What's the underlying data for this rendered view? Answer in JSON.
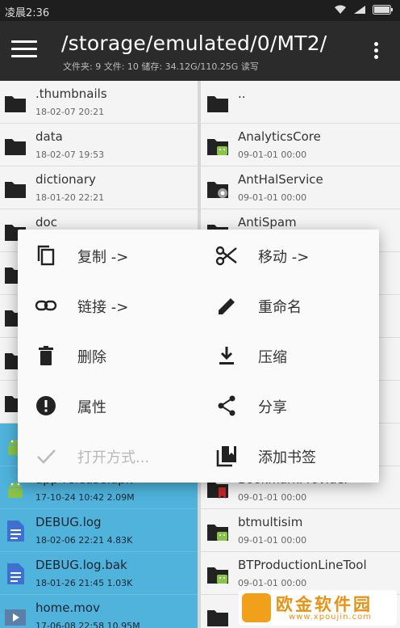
{
  "status_bar": {
    "time": "凌晨2:36"
  },
  "app_bar": {
    "path": "/storage/emulated/0/MT2/",
    "info": "文件夹: 9  文件: 10  储存: 34.12G/110.25G  读写"
  },
  "left_pane": {
    "rows": [
      {
        "name": ".thumbnails",
        "meta": "18-02-07 20:21",
        "icon": "folder-icon"
      },
      {
        "name": "data",
        "meta": "18-02-07 19:53",
        "icon": "folder-icon"
      },
      {
        "name": "dictionary",
        "meta": "18-01-20 22:21",
        "icon": "folder-icon"
      },
      {
        "name": "doc",
        "meta": "",
        "icon": "folder-icon"
      },
      {
        "name": "",
        "meta": "",
        "icon": "folder-icon"
      },
      {
        "name": "",
        "meta": "",
        "icon": "folder-icon"
      },
      {
        "name": "",
        "meta": "",
        "icon": "folder-icon"
      },
      {
        "name": "",
        "meta": "",
        "icon": "folder-icon"
      },
      {
        "name": "",
        "meta": "",
        "icon": "android-icon"
      },
      {
        "name": "app-release.apk",
        "meta": "17-10-24 10:42  2.09M",
        "icon": "android-icon"
      },
      {
        "name": "DEBUG.log",
        "meta": "18-02-06 22:21  4.83K",
        "icon": "document-icon"
      },
      {
        "name": "DEBUG.log.bak",
        "meta": "18-01-26 21:45  1.03K",
        "icon": "document-icon"
      },
      {
        "name": "home.mov",
        "meta": "17-06-08 22:58  10.95M",
        "icon": "video-icon"
      }
    ]
  },
  "right_pane": {
    "rows": [
      {
        "name": "..",
        "meta": "",
        "icon": "folder-icon"
      },
      {
        "name": "AnalyticsCore",
        "meta": "09-01-01 00:00",
        "icon": "folder-android-icon"
      },
      {
        "name": "AntHalService",
        "meta": "09-01-01 00:00",
        "icon": "folder-settings-icon"
      },
      {
        "name": "AntiSpam",
        "meta": "",
        "icon": "folder-icon"
      },
      {
        "name": "",
        "meta": "",
        "icon": "folder-icon"
      },
      {
        "name": "",
        "meta": "",
        "icon": "folder-icon"
      },
      {
        "name": "",
        "meta": "",
        "icon": "folder-icon"
      },
      {
        "name": "",
        "meta": "",
        "icon": "folder-icon"
      },
      {
        "name": "",
        "meta": "",
        "icon": "folder-icon"
      },
      {
        "name": "BookmarkProvider",
        "meta": "09-01-01 00:00",
        "icon": "folder-bookmark-icon"
      },
      {
        "name": "btmultisim",
        "meta": "09-01-01 00:00",
        "icon": "folder-android-icon"
      },
      {
        "name": "BTProductionLineTool",
        "meta": "09-01-01 00:00",
        "icon": "folder-android-icon"
      },
      {
        "name": "",
        "meta": "",
        "icon": "folder-icon"
      }
    ]
  },
  "popup_menu": {
    "items": [
      {
        "label": "复制 ->",
        "icon": "copy-icon",
        "enabled": true
      },
      {
        "label": "移动 ->",
        "icon": "scissors-icon",
        "enabled": true
      },
      {
        "label": "链接 ->",
        "icon": "link-icon",
        "enabled": true
      },
      {
        "label": "重命名",
        "icon": "pencil-icon",
        "enabled": true
      },
      {
        "label": "删除",
        "icon": "trash-icon",
        "enabled": true
      },
      {
        "label": "压缩",
        "icon": "download-icon",
        "enabled": true
      },
      {
        "label": "属性",
        "icon": "info-alert-icon",
        "enabled": true
      },
      {
        "label": "分享",
        "icon": "share-icon",
        "enabled": true
      },
      {
        "label": "打开方式...",
        "icon": "check-icon",
        "enabled": false
      },
      {
        "label": "添加书签",
        "icon": "bookmark-collection-icon",
        "enabled": true
      }
    ]
  },
  "watermark": {
    "title": "欧金软件园",
    "subtitle": "www.xpoujin.com"
  },
  "colors": {
    "app_bar": "#2b2b2b",
    "selection": "#4fb3dc",
    "icon_dark": "#222222",
    "android_green": "#8bc34a"
  }
}
